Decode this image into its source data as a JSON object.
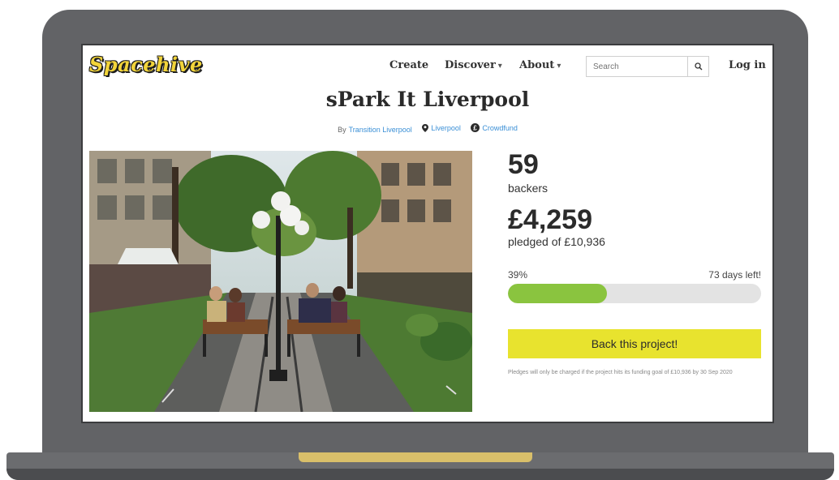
{
  "nav": {
    "logo": "Spacehive",
    "links": [
      {
        "label": "Create"
      },
      {
        "label": "Discover"
      },
      {
        "label": "About"
      }
    ],
    "search_placeholder": "Search",
    "login": "Log in"
  },
  "project": {
    "title": "sPark It Liverpool",
    "by_prefix": "By",
    "author": "Transition Liverpool",
    "location": "Liverpool",
    "funding_type": "Crowdfund",
    "photo_alt": "Street photo"
  },
  "stats": {
    "backers": "59",
    "backers_label": "backers",
    "pledged": "£4,259",
    "pledged_label": "pledged of £10,936",
    "percent_label": "39%",
    "progress": 0.39,
    "days_left": "73 days left!"
  },
  "cta": {
    "label": "Back this project!",
    "fine_print": "Pledges will only be charged if the project hits its funding goal of £10,936 by 30 Sep 2020"
  },
  "colors": {
    "progress": "#8ac43f",
    "cta": "#e8e32e",
    "logo": "#f2d43a",
    "link": "#3a8fd6"
  }
}
